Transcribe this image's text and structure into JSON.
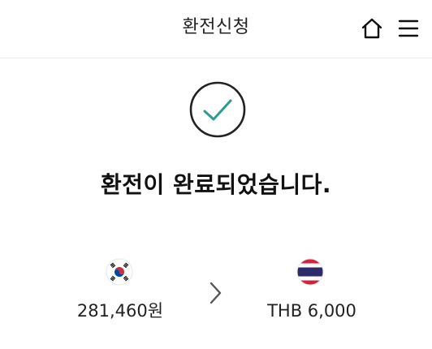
{
  "header": {
    "title": "환전신청",
    "home_icon": "home-icon",
    "menu_icon": "hamburger-menu-icon"
  },
  "status": {
    "icon": "check-circle-icon",
    "message": "환전이 완료되었습니다."
  },
  "exchange": {
    "from": {
      "flag": "korea-flag-icon",
      "amount": "281,460원"
    },
    "arrow_icon": "chevron-right-icon",
    "to": {
      "flag": "thailand-flag-icon",
      "amount": "THB 6,000"
    }
  },
  "colors": {
    "check": "#2a9d8f",
    "circle": "#222222",
    "divider": "#eeeeee",
    "thai_red": "#d1233c",
    "thai_blue": "#2d2a69",
    "korea_red": "#cd2e3a",
    "korea_blue": "#0047a0"
  }
}
